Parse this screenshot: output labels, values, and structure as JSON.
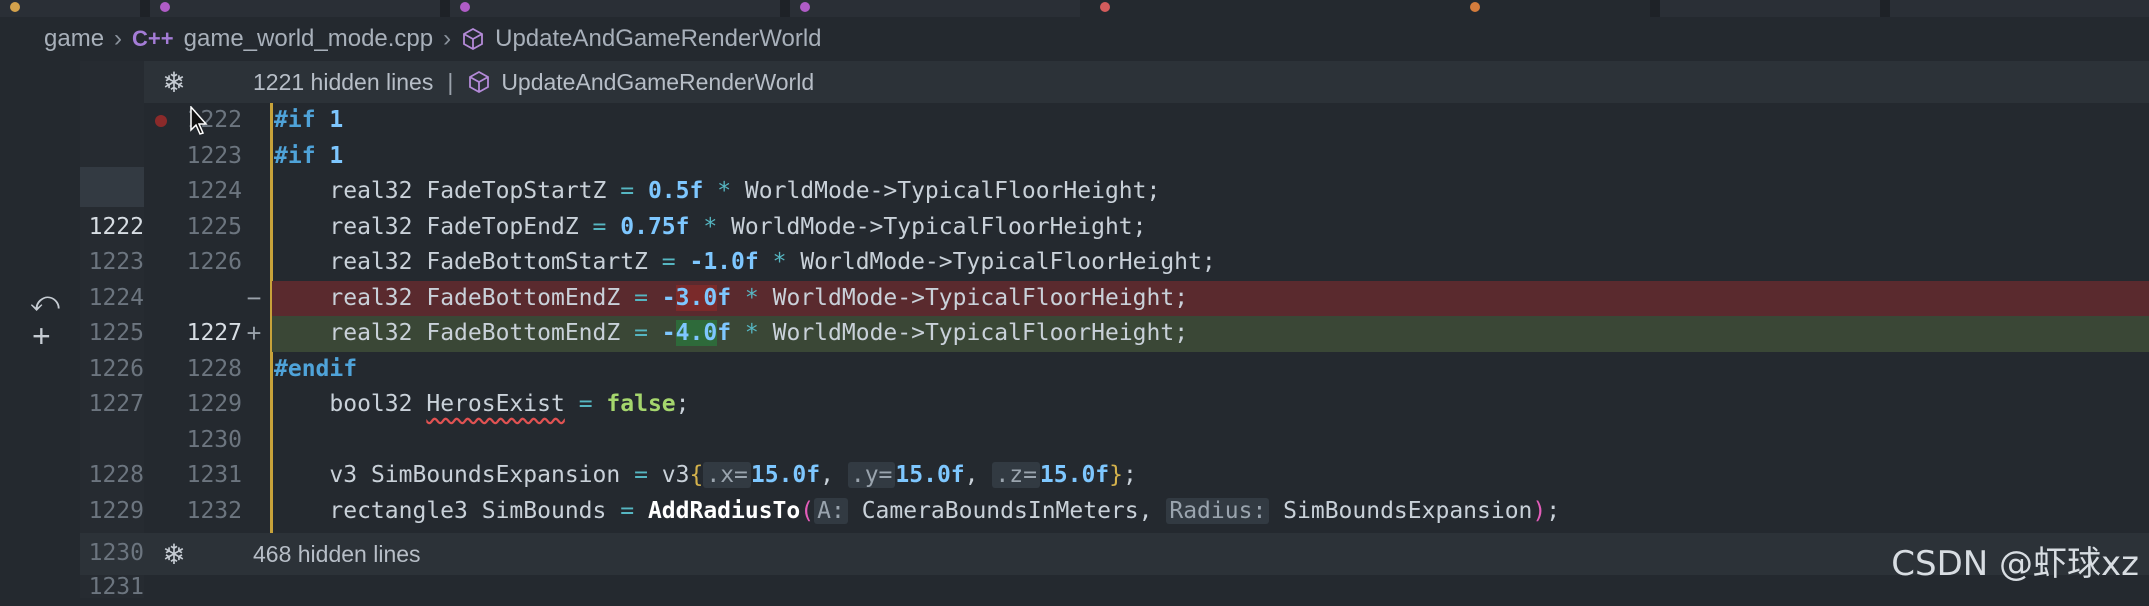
{
  "breadcrumb": {
    "folder": "game",
    "file_icon": "C++",
    "file": "game_world_mode.cpp",
    "symbol": "UpdateAndGameRenderWorld"
  },
  "fold_top": {
    "text": "1221 hidden lines",
    "separator": "|",
    "symbol": "UpdateAndGameRenderWorld"
  },
  "fold_bottom": {
    "text": "468 hidden lines"
  },
  "rows": [
    {
      "a": "",
      "b": "1222"
    },
    {
      "a": "",
      "b": "1223"
    },
    {
      "a": "",
      "b": "1224"
    },
    {
      "a": "1222",
      "b": "1225"
    },
    {
      "a": "1223",
      "b": "1226"
    },
    {
      "a": "1224",
      "b": ""
    },
    {
      "a": "1225",
      "b": "1227"
    },
    {
      "a": "1226",
      "b": "1228"
    },
    {
      "a": "1227",
      "b": "1229"
    },
    {
      "a": "",
      "b": "1230"
    },
    {
      "a": "1228",
      "b": "1231"
    },
    {
      "a": "1229",
      "b": "1232"
    }
  ],
  "ln_after_fold": {
    "a": "1230",
    "b": ""
  },
  "ln_last": {
    "a": "1231"
  },
  "code": {
    "pp_if": "#if",
    "one": "1",
    "pp_endif": "#endif",
    "real32": "real32",
    "bool32": "bool32",
    "v3": "v3",
    "rectangle3": "rectangle3",
    "fade_top_start": "FadeTopStartZ",
    "fade_top_end": "FadeTopEndZ",
    "fade_bottom_start": "FadeBottomStartZ",
    "fade_bottom_end": "FadeBottomEndZ",
    "eq": "=",
    "mul": "*",
    "world": "WorldMode->TypicalFloorHeight;",
    "v05": "0.5",
    "v075": "0.75",
    "v10": "-1.0",
    "neg": "-",
    "v30": "3.0",
    "v40": "4.0",
    "f": "f",
    "heros": "HerosExist",
    "false": "false",
    "semi": ";",
    "sim_exp": "SimBoundsExpansion",
    "sim_bounds": "SimBounds",
    "v3open": "v3",
    "brace_open": "{",
    "brace_close": "}",
    "hint_x": ".x=",
    "hint_y": ".y=",
    "hint_z": ".z=",
    "v15": "15.0f",
    "comma": ",",
    "add_radius": "AddRadiusTo",
    "paren_open": "(",
    "paren_close": ")",
    "hint_a": "A:",
    "camera": "CameraBoundsInMeters",
    "hint_radius": "Radius:",
    "sim_exp_arg": "SimBoundsExpansion"
  },
  "diff_marks": {
    "minus": "−",
    "plus": "+"
  },
  "icons": {
    "fold": "snowflake-icon",
    "revert": "revert-icon",
    "add": "plus-icon",
    "breakpoint": "breakpoint-dot-icon",
    "cube": "symbol-method-icon",
    "chevron": "chevron-right-icon"
  },
  "watermark": "CSDN @虾球xz",
  "colors": {
    "removed_bg": "#5a2a2e",
    "added_bg": "#3a4736",
    "modified_bar": "#c7a23a",
    "keyword_pp": "#4fa3d9",
    "number": "#7ec7ff",
    "bool": "#a5d66d"
  }
}
